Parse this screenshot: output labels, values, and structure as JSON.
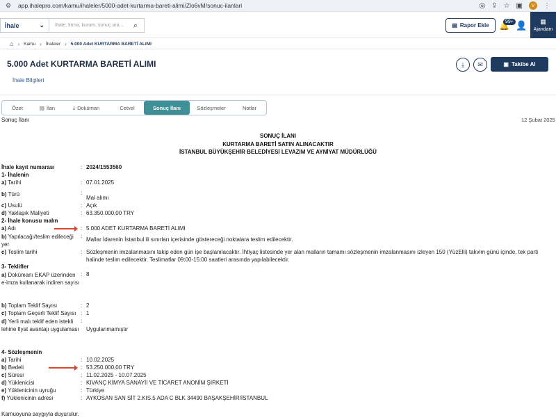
{
  "browser": {
    "url": "app.ihalepro.com/kamu/ihaleler/5000-adet-kurtarma-bareti-alimi/Zlo6vM/sonuc-ilanlari",
    "avatar_letter": "V"
  },
  "header": {
    "category": "İhale",
    "search_placeholder": "İhale, firma, kurum, sonuç ara...",
    "report_label": "Rapor Ekle",
    "notif_count": "99+",
    "agenda_label": "Ajandam"
  },
  "breadcrumb": [
    "Kamu",
    "İhaleler",
    "5.000 Adet KURTARMA BARETİ ALIMI"
  ],
  "title": "5.000 Adet KURTARMA BARETİ ALIMI",
  "info_link": "İhale Bilgileri",
  "follow_label": "Takibe Al",
  "tabs": [
    "Özet",
    "İlan",
    "Doküman",
    "Cetvel",
    "Sonuç İlanı",
    "Sözleşmeler",
    "Notlar"
  ],
  "doc": {
    "label": "Sonuç İlanı",
    "date": "12 Şubat 2025",
    "heading1": "SONUÇ İLANI",
    "heading2": "KURTARMA BARETİ SATIN ALINACAKTIR",
    "heading3": "İSTANBUL BÜYÜKŞEHİR BELEDİYESİ LEVAZIM VE AYNİYAT MÜDÜRLÜĞÜ",
    "kayit_label": "İhale kayıt numarası",
    "kayit_value": "2024/1553560",
    "sec1": "1- İhalenin",
    "s1": [
      {
        "key": "a)",
        "label": "Tarihi",
        "value": "07.01.2025"
      },
      {
        "key": "b)",
        "label": "Türü",
        "value": "Mal alımı"
      },
      {
        "key": "c)",
        "label": "Usulü",
        "value": "Açık"
      },
      {
        "key": "d)",
        "label": "Yaklaşık Maliyeti",
        "value": "63.350.000,00 TRY"
      }
    ],
    "sec2": "2- İhale konusu malın",
    "s2": [
      {
        "key": "a)",
        "label": "Adı",
        "value": "5.000 ADET KURTARMA BARETİ ALIMI"
      },
      {
        "key": "b)",
        "label": "Yapılacağı/teslim edileceği yer",
        "value": "Mallar İdarenin İstanbul ili sınırları içerisinde göstereceği noktalara teslim edilecektir."
      },
      {
        "key": "c)",
        "label": "Teslim tarihi",
        "value": "Sözleşmenin imzalanmasını takip eden gün işe başlanılacaktır. İhtiyaç listesinde yer alan malların tamamı sözleşmenin imzalanmasını izleyen 150 (YüzElli) takvim günü içinde, tek parti halinde teslim edilecektir. Teslimatlar 09:00-15:00 saatleri arasında yapılabilecektir."
      }
    ],
    "sec3": "3- Teklifler",
    "s3": [
      {
        "key": "a)",
        "label": "Dokümanı EKAP üzerinden e-imza kullanarak indiren sayısı",
        "value": "8"
      },
      {
        "key": "b)",
        "label": "Toplam Teklif Sayısı",
        "value": "2"
      },
      {
        "key": "c)",
        "label": "Toplam Geçerli Teklif Sayısı",
        "value": "1"
      },
      {
        "key": "d)",
        "label": "Yerli malı teklif eden istekli lehine fiyat avantajı uygulaması",
        "value": "Uygulanmamıştır"
      }
    ],
    "sec4": "4- Sözleşmenin",
    "s4": [
      {
        "key": "a)",
        "label": "Tarihi",
        "value": "10.02.2025"
      },
      {
        "key": "b)",
        "label": "Bedeli",
        "value": "53.250.000,00 TRY"
      },
      {
        "key": "c)",
        "label": "Süresi",
        "value": "11.02.2025 - 10.07.2025"
      },
      {
        "key": "d)",
        "label": "Yüklenicisi",
        "value": "KIVANÇ KİMYA SANAYİİ VE TİCARET ANONİM ŞİRKETİ"
      },
      {
        "key": "e)",
        "label": "Yüklenicinin uyruğu",
        "value": "Türkiye"
      },
      {
        "key": "f)",
        "label": "Yüklenicinin adresi",
        "value": "AYKOSAN SAN SİT 2.KIS.5 ADA C BLK 34490 BAŞAKŞEHİR/İSTANBUL"
      }
    ],
    "footer": "Kamuoyuna saygıyla duyurulur."
  },
  "colors": {
    "brand": "#1e3a5f",
    "active_tab": "#3f8f97",
    "arrow": "#d9472f"
  }
}
